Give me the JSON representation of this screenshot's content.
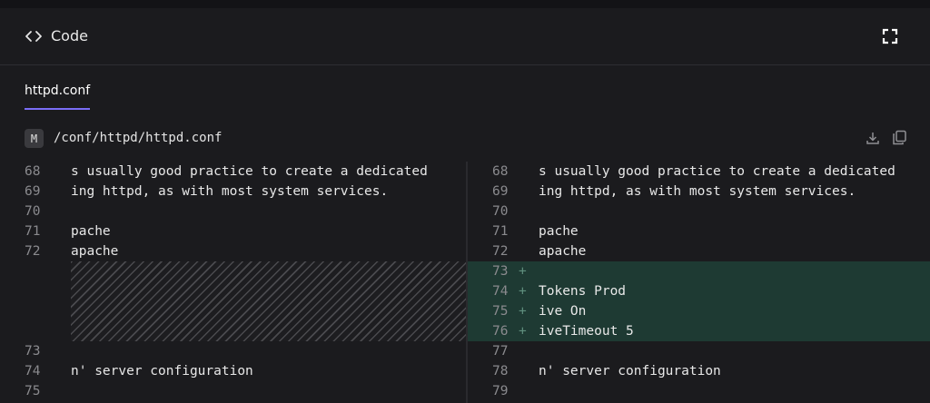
{
  "header": {
    "title": "Code",
    "code_icon": "code-brackets-icon",
    "expand_icon": "expand-icon"
  },
  "tabs": [
    {
      "label": "httpd.conf",
      "active": true
    }
  ],
  "file": {
    "badge": "M",
    "path": "/conf/httpd/httpd.conf",
    "download_icon": "download-icon",
    "copy_icon": "copy-icon"
  },
  "colors": {
    "accent": "#7b6ef6",
    "added_bg": "#1e3a33",
    "background": "#1b1b1e"
  },
  "diff": {
    "left": [
      {
        "n": "68",
        "text": "s usually good practice to create a dedicated"
      },
      {
        "n": "69",
        "text": "ing httpd, as with most system services."
      },
      {
        "n": "70",
        "text": ""
      },
      {
        "n": "71",
        "text": "pache"
      },
      {
        "n": "72",
        "text": "apache"
      },
      {
        "n": "",
        "text": ""
      },
      {
        "n": "",
        "text": ""
      },
      {
        "n": "",
        "text": ""
      },
      {
        "n": "",
        "text": ""
      },
      {
        "n": "73",
        "text": ""
      },
      {
        "n": "74",
        "text": "n' server configuration"
      },
      {
        "n": "75",
        "text": ""
      }
    ],
    "right": [
      {
        "n": "68",
        "mark": "",
        "text": "s usually good practice to create a dedicated"
      },
      {
        "n": "69",
        "mark": "",
        "text": "ing httpd, as with most system services."
      },
      {
        "n": "70",
        "mark": "",
        "text": ""
      },
      {
        "n": "71",
        "mark": "",
        "text": "pache"
      },
      {
        "n": "72",
        "mark": "",
        "text": "apache"
      },
      {
        "n": "73",
        "mark": "+",
        "text": ""
      },
      {
        "n": "74",
        "mark": "+",
        "text": "Tokens Prod"
      },
      {
        "n": "75",
        "mark": "+",
        "text": "ive On"
      },
      {
        "n": "76",
        "mark": "+",
        "text": "iveTimeout 5"
      },
      {
        "n": "77",
        "mark": "",
        "text": ""
      },
      {
        "n": "78",
        "mark": "",
        "text": "n' server configuration"
      },
      {
        "n": "79",
        "mark": "",
        "text": ""
      }
    ]
  }
}
